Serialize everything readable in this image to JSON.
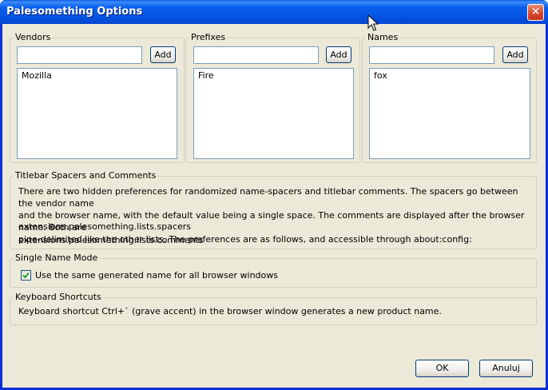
{
  "window": {
    "title": "Palesomething Options",
    "close_glyph": "✕"
  },
  "vendors": {
    "label": "Vendors",
    "add_label": "Add",
    "input_value": "",
    "items": [
      "Mozilla"
    ]
  },
  "prefixes": {
    "label": "Prefixes",
    "add_label": "Add",
    "input_value": "",
    "items": [
      "Fire"
    ]
  },
  "names": {
    "label": "Names",
    "add_label": "Add",
    "input_value": "",
    "items": [
      "fox"
    ]
  },
  "spacers": {
    "label": "Titlebar Spacers and Comments",
    "description_line1": "There are two hidden preferences for randomized name-spacers and titlebar comments. The spacers go between the vendor name",
    "description_line2": "and the browser name, with the default value being a single space. The comments are displayed after the browser name. Both are",
    "description_line3": "pipe-delimited like the other lists. The preferences are as follows, and accessible through about:config:",
    "pref1": "extensions.palesomething.lists.spacers",
    "pref2": "extensions.palesomething.lists.comments"
  },
  "single_name": {
    "label": "Single Name Mode",
    "checkbox_label": "Use the same generated name for all browser windows",
    "checked": true
  },
  "shortcuts": {
    "label": "Keyboard Shortcuts",
    "text": "Keyboard shortcut Ctrl+` (grave accent) in the browser window generates a new product name."
  },
  "footer": {
    "ok_label": "OK",
    "cancel_label": "Anuluj"
  },
  "colors": {
    "title_bar": "#0553e1",
    "dialog_bg": "#ece9d8",
    "close_button": "#d4432a",
    "input_border": "#7f9db9"
  }
}
